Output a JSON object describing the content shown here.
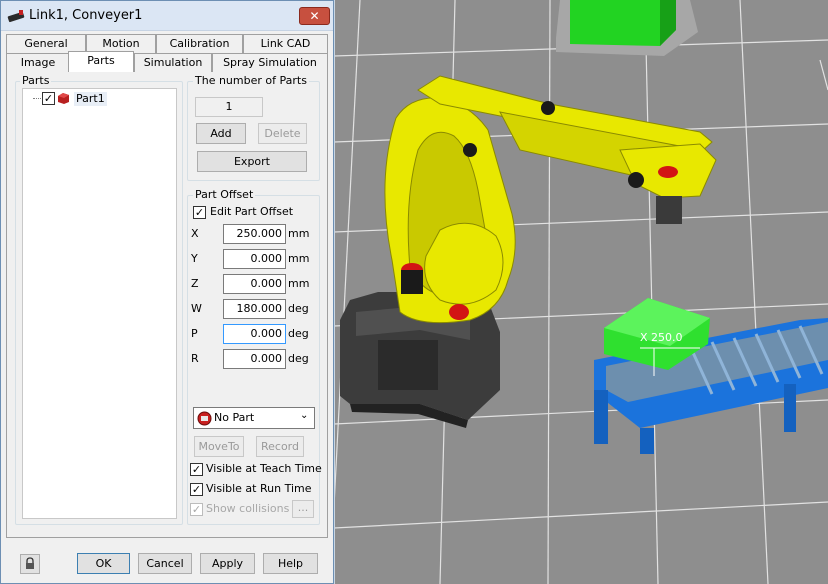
{
  "window": {
    "title": "Link1, Conveyer1",
    "close_label": "✕"
  },
  "tabs_row1": [
    "General",
    "Motion",
    "Calibration",
    "Link CAD"
  ],
  "tabs_row2": [
    "Image",
    "Parts",
    "Simulation",
    "Spray Simulation"
  ],
  "active_tab": "Parts",
  "parts_panel": {
    "group_label": "Parts",
    "tree_item": "Part1",
    "tree_item_checked": true
  },
  "number_of_parts": {
    "group_label": "The number of Parts",
    "value": "1",
    "add_label": "Add",
    "delete_label": "Delete"
  },
  "export_label": "Export",
  "part_offset": {
    "group_label": "Part Offset",
    "edit_label": "Edit Part Offset",
    "edit_checked": true,
    "fields": [
      {
        "label": "X",
        "value": "250.000",
        "unit": "mm"
      },
      {
        "label": "Y",
        "value": "0.000",
        "unit": "mm"
      },
      {
        "label": "Z",
        "value": "0.000",
        "unit": "mm"
      },
      {
        "label": "W",
        "value": "180.000",
        "unit": "deg"
      },
      {
        "label": "P",
        "value": "0.000",
        "unit": "deg"
      },
      {
        "label": "R",
        "value": "0.000",
        "unit": "deg"
      }
    ]
  },
  "part_select": {
    "value": "No Part"
  },
  "moveto_label": "MoveTo",
  "record_label": "Record",
  "visible_teach": {
    "label": "Visible at Teach Time",
    "checked": true
  },
  "visible_run": {
    "label": "Visible at Run Time",
    "checked": true
  },
  "show_collisions": {
    "label": "Show collisions",
    "checked": true,
    "more_label": "..."
  },
  "bottom_buttons": {
    "ok": "OK",
    "cancel": "Cancel",
    "apply": "Apply",
    "help": "Help"
  },
  "viewport": {
    "offset_annotation": "X 250.0",
    "robot_color": "#e8e800",
    "part_color": "#2fe02f",
    "conveyor_color": "#1a73d9",
    "base_color": "#3a3a3a",
    "floor_color": "#8c8c8c"
  }
}
